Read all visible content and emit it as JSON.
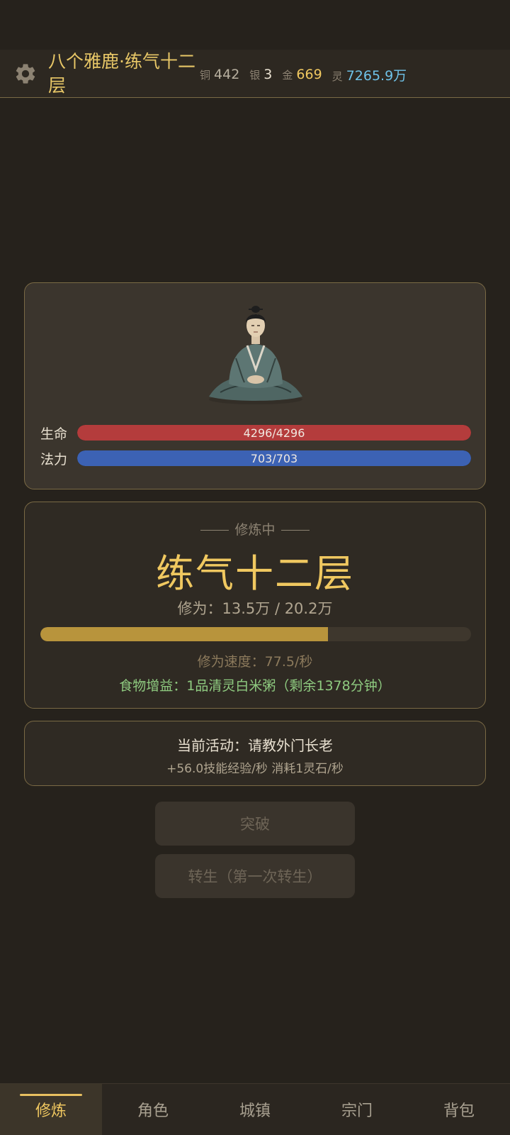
{
  "header": {
    "player_name": "八个雅鹿·练气十二层",
    "currencies": [
      {
        "label": "铜",
        "value": "442",
        "color": "#b8b0a0"
      },
      {
        "label": "银",
        "value": "3",
        "color": "#e8e0d0"
      },
      {
        "label": "金",
        "value": "669",
        "color": "#f0c860"
      },
      {
        "label": "灵",
        "value": "7265.9万",
        "color": "#6fc2e8"
      }
    ]
  },
  "character": {
    "hp": {
      "label": "生命",
      "text": "4296/4296",
      "fraction": 1.0,
      "color": "#b43c3c"
    },
    "mp": {
      "label": "法力",
      "text": "703/703",
      "fraction": 1.0,
      "color": "#3c62b4"
    }
  },
  "cultivation": {
    "status": "修炼中",
    "realm": "练气十二层",
    "xiuwei": "修为：13.5万 / 20.2万",
    "progress_fraction": 0.668,
    "speed": "修为速度：77.5/秒",
    "food": "食物增益：1品清灵白米粥（剩余1378分钟）"
  },
  "activity": {
    "title": "当前活动：请教外门长老",
    "detail": "+56.0技能经验/秒  消耗1灵石/秒"
  },
  "buttons": {
    "breakthrough": "突破",
    "rebirth": "转生（第一次转生）"
  },
  "nav": {
    "items": [
      {
        "label": "修炼",
        "active": true
      },
      {
        "label": "角色",
        "active": false
      },
      {
        "label": "城镇",
        "active": false
      },
      {
        "label": "宗门",
        "active": false
      },
      {
        "label": "背包",
        "active": false
      }
    ]
  }
}
